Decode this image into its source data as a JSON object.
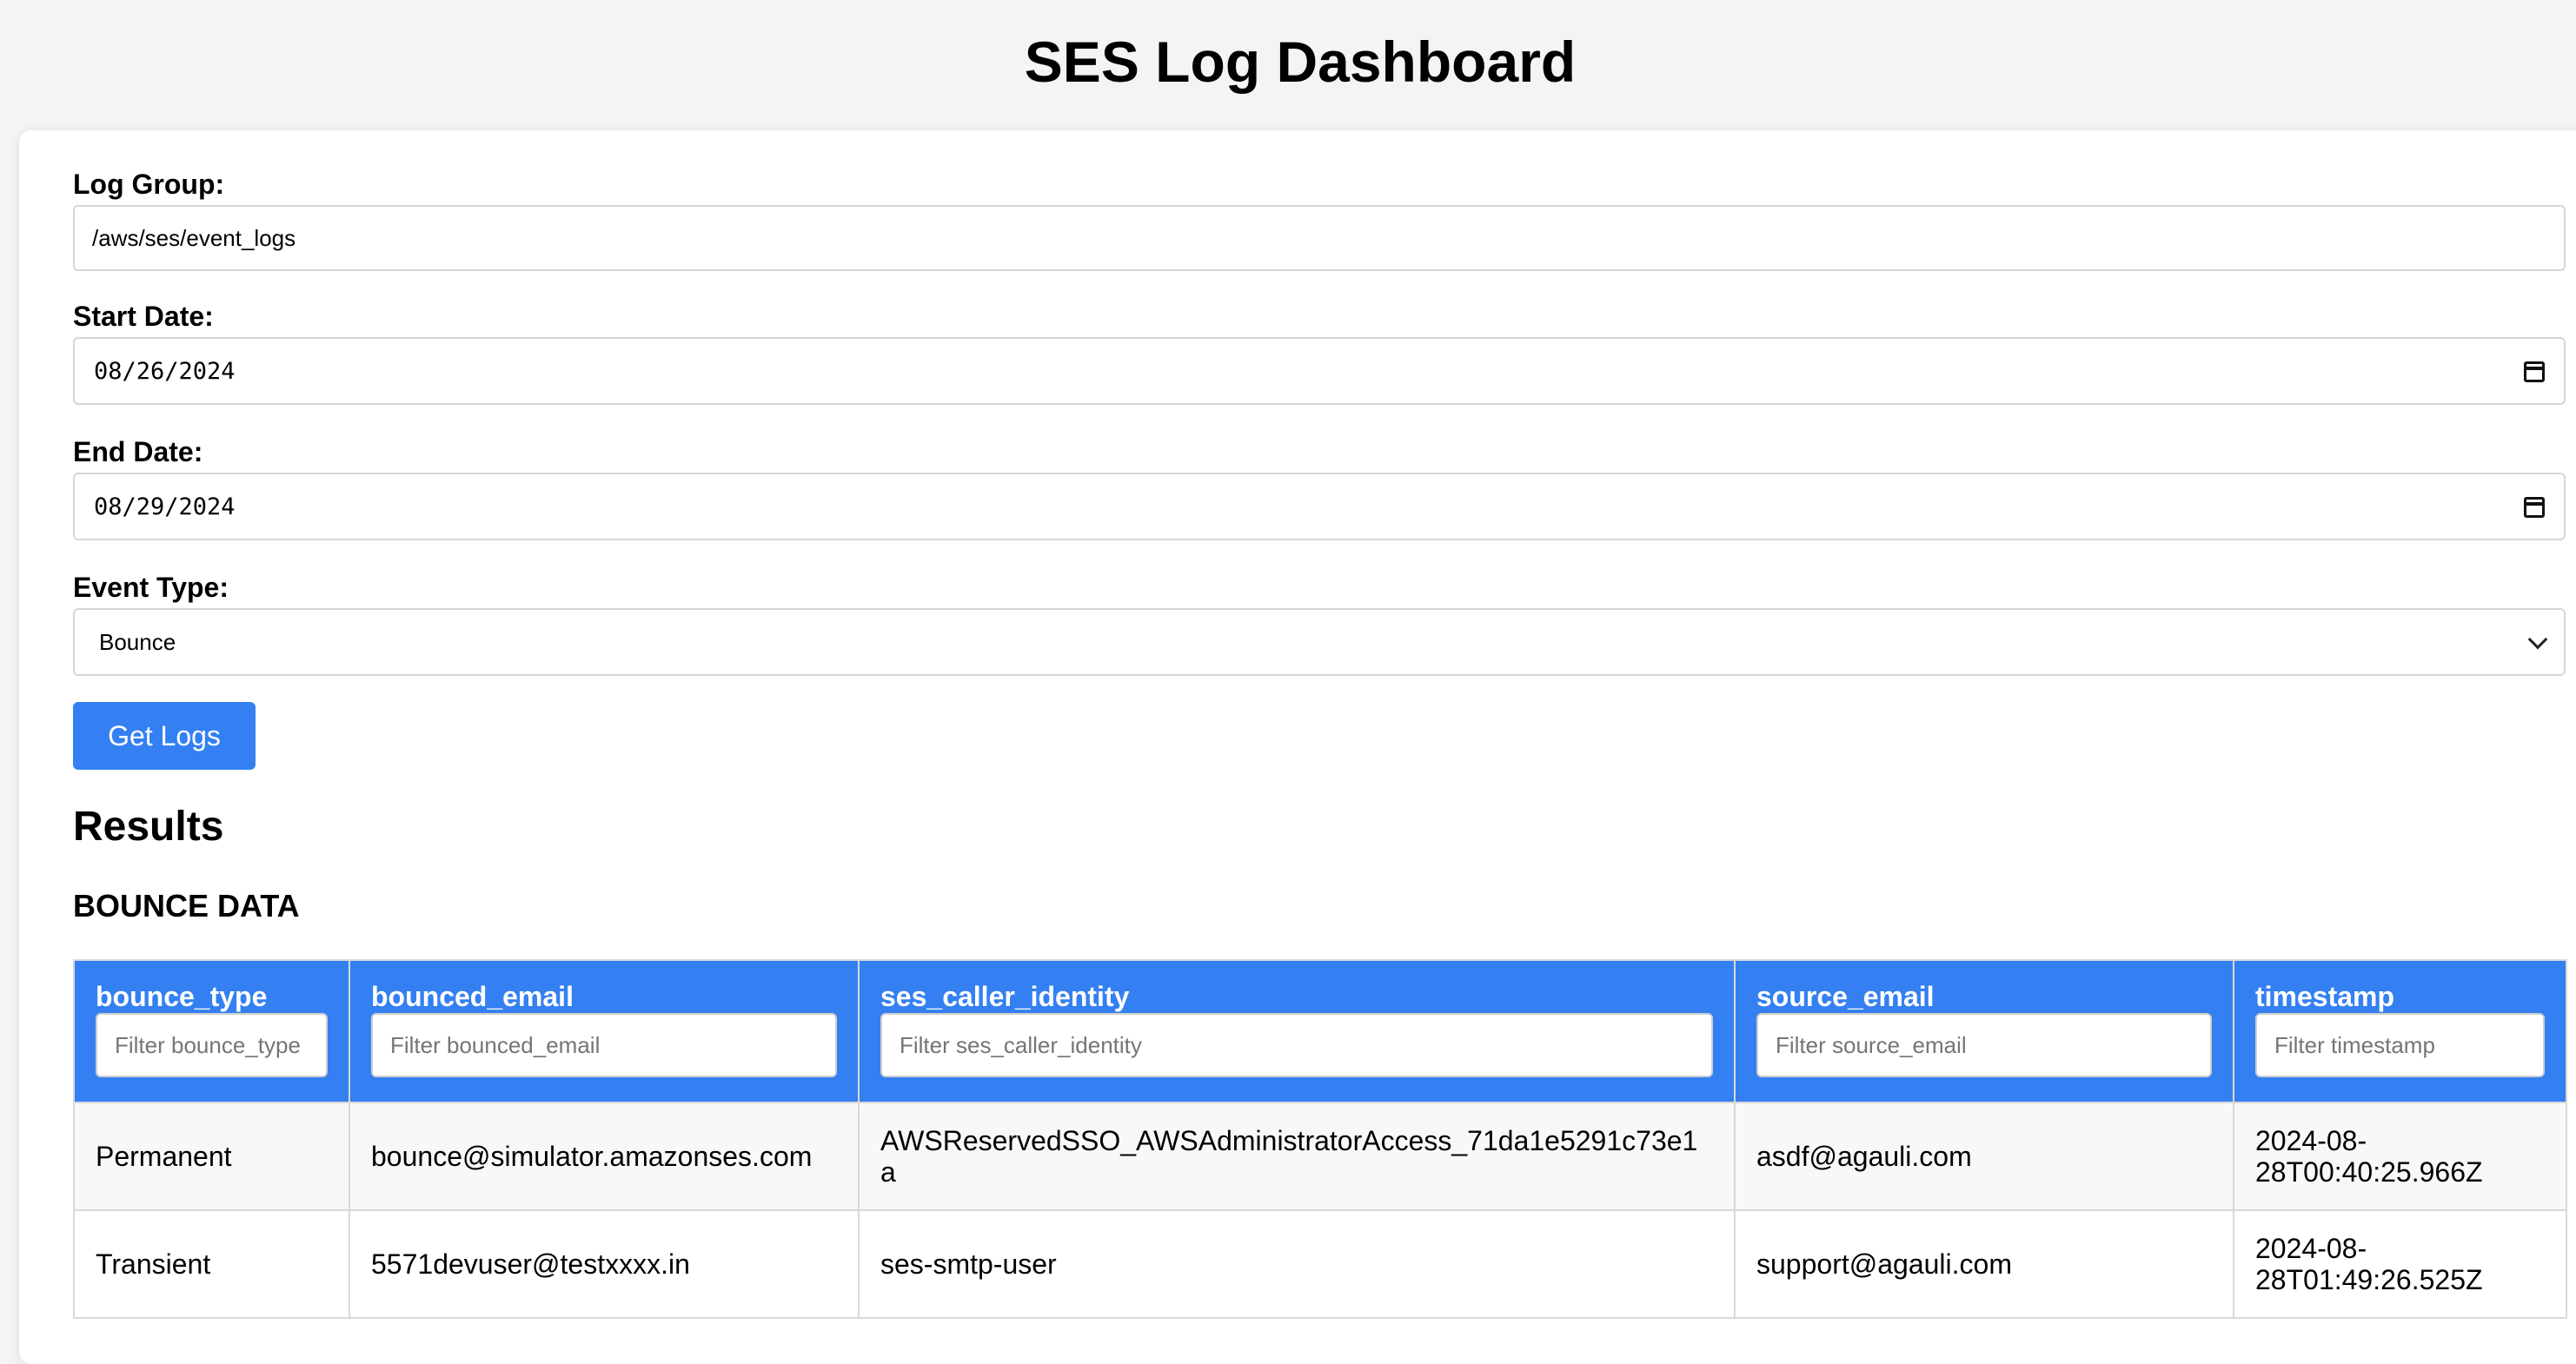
{
  "title": "SES Log Dashboard",
  "form": {
    "log_group_label": "Log Group:",
    "log_group_value": "/aws/ses/event_logs",
    "start_date_label": "Start Date:",
    "start_date_value": "08/26/2024",
    "end_date_label": "End Date:",
    "end_date_value": "08/29/2024",
    "event_type_label": "Event Type:",
    "event_type_value": "Bounce",
    "get_logs_label": "Get Logs"
  },
  "results": {
    "heading": "Results",
    "section_title": "BOUNCE DATA",
    "columns": [
      {
        "key": "bounce_type",
        "label": "bounce_type",
        "filter_placeholder": "Filter bounce_type"
      },
      {
        "key": "bounced_email",
        "label": "bounced_email",
        "filter_placeholder": "Filter bounced_email"
      },
      {
        "key": "ses_caller_identity",
        "label": "ses_caller_identity",
        "filter_placeholder": "Filter ses_caller_identity"
      },
      {
        "key": "source_email",
        "label": "source_email",
        "filter_placeholder": "Filter source_email"
      },
      {
        "key": "timestamp",
        "label": "timestamp",
        "filter_placeholder": "Filter timestamp"
      }
    ],
    "rows": [
      {
        "bounce_type": "Permanent",
        "bounced_email": "bounce@simulator.amazonses.com",
        "ses_caller_identity": "AWSReservedSSO_AWSAdministratorAccess_71da1e5291c73e1a",
        "source_email": "asdf@agauli.com",
        "timestamp": "2024-08-28T00:40:25.966Z"
      },
      {
        "bounce_type": "Transient",
        "bounced_email": "5571devuser@testxxxx.in",
        "ses_caller_identity": "ses-smtp-user",
        "source_email": "support@agauli.com",
        "timestamp": "2024-08-28T01:49:26.525Z"
      }
    ]
  },
  "colors": {
    "primary": "#3480f2",
    "page_background": "#f4f4f4",
    "card_background": "#ffffff"
  }
}
